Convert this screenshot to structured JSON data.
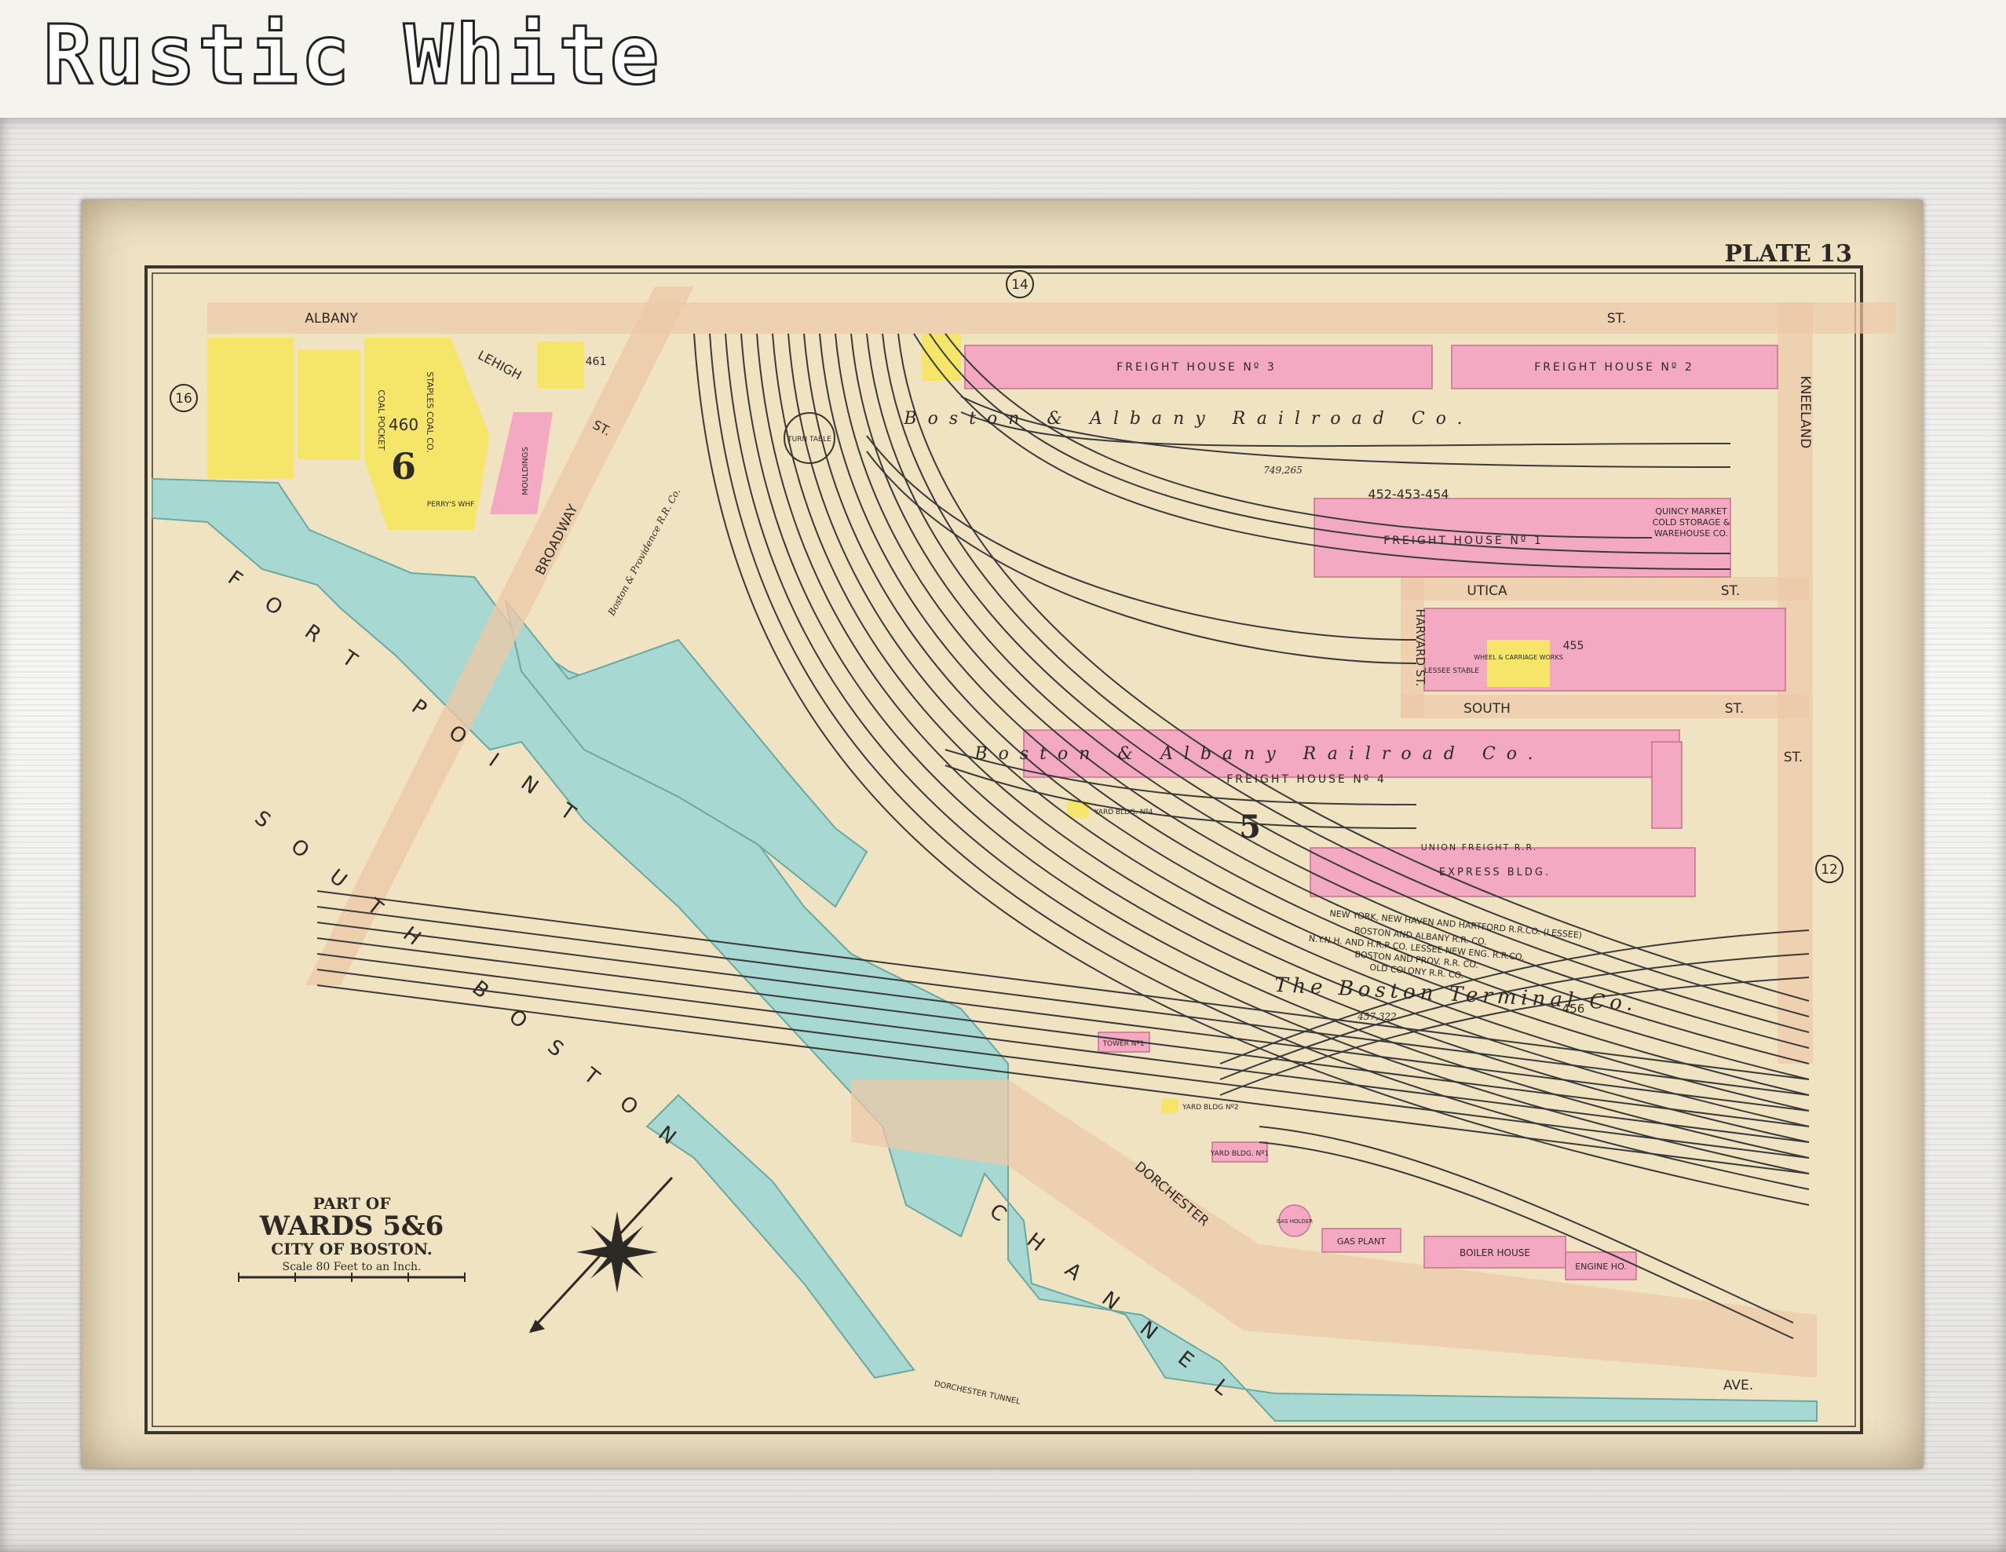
{
  "header": {
    "title": "Rustic White"
  },
  "map": {
    "plate": "PLATE 13",
    "title": {
      "part_of": "PART OF",
      "wards": "WARDS 5&6",
      "city": "CITY OF BOSTON.",
      "scale": "Scale 80 Feet to an Inch."
    },
    "ward_numbers": {
      "ward_6": "6",
      "ward_5": "5"
    },
    "plate_refs": {
      "top": "14",
      "left": "16",
      "right": "12"
    },
    "streets": {
      "albany": "ALBANY",
      "st_top": "ST.",
      "lehigh": "LEHIGH",
      "lehigh_st": "ST.",
      "broadway": "BROADWAY",
      "kneeland": "KNEELAND",
      "utica": "UTICA",
      "utica_st": "ST.",
      "harvard": "HARVARD ST.",
      "south": "SOUTH",
      "south_st": "ST.",
      "right_st": "ST.",
      "dorchester": "DORCHESTER",
      "ave": "AVE."
    },
    "water": {
      "fort_point": "FORT POINT",
      "south_boston": "SOUTH BOSTON",
      "channel": "CHANNEL"
    },
    "buildings": {
      "freight_house_3": "FREIGHT HOUSE Nº 3",
      "freight_house_2": "FREIGHT HOUSE Nº 2",
      "freight_house_1": "FREIGHT HOUSE Nº 1",
      "freight_house_4": "FREIGHT HOUSE Nº 4",
      "lot_452_454": "452-453-454",
      "quincy_line1": "QUINCY MARKET",
      "quincy_line2": "COLD STORAGE &",
      "quincy_line3": "WAREHOUSE CO.",
      "express_bldg": "EXPRESS BLDG.",
      "yard_bldg_4": "YARD BLDG. Nº4",
      "yard_bldg_2": "YARD BLDG Nº2",
      "yard_bldg_1": "YARD BLDG. Nº1",
      "tower": "TOWER Nº1",
      "gas_holder": "GAS HOLDER",
      "gas_plant": "GAS PLANT",
      "boiler_house": "BOILER HOUSE",
      "engine_ho": "ENGINE HO.",
      "turn_table": "TURN TABLE",
      "lot_460": "460",
      "lot_461": "461",
      "lot_455": "455",
      "lot_456": "456",
      "staples_coal": "STAPLES COAL CO.",
      "coal_pocket": "COAL POCKET",
      "perrys_wharf": "PERRY'S WHF",
      "mouldings": "MOULDINGS",
      "wheel_works": "WHEEL & CARRIAGE WORKS",
      "lessee_stable": "LESSEE STABLE"
    },
    "railroads": {
      "boston_albany_top": "Boston & Albany Railroad Co.",
      "boston_albany_mid": "Boston & Albany Railroad Co.",
      "boston_providence": "Boston & Providence R.R. Co.",
      "union_freight": "UNION FREIGHT R.R.",
      "nyh_line1": "NEW YORK, NEW HAVEN AND HARTFORD R.R.CO. (LESSEE)",
      "nyh_line2": "BOSTON AND ALBANY R.R. CO.",
      "nyh_line3": "N.Y.N.H. AND H.R.R.CO. LESSEE NEW ENG. R.R.CO.",
      "nyh_line4": "BOSTON AND PROV. R.R. CO.",
      "nyh_line5": "OLD COLONY R.R. CO.",
      "terminal": "The Boston Terminal Co.",
      "dorchester_tunnel": "DORCHESTER TUNNEL"
    },
    "areas": {
      "a1": "749,265",
      "a2": "457,322"
    },
    "colors": {
      "paper": "#f0e3c1",
      "water": "#a7d8d1",
      "pink": "#f3a9c2",
      "yellow": "#f5e66a",
      "street": "#ecc9a8",
      "ink": "#2d2a25"
    }
  }
}
